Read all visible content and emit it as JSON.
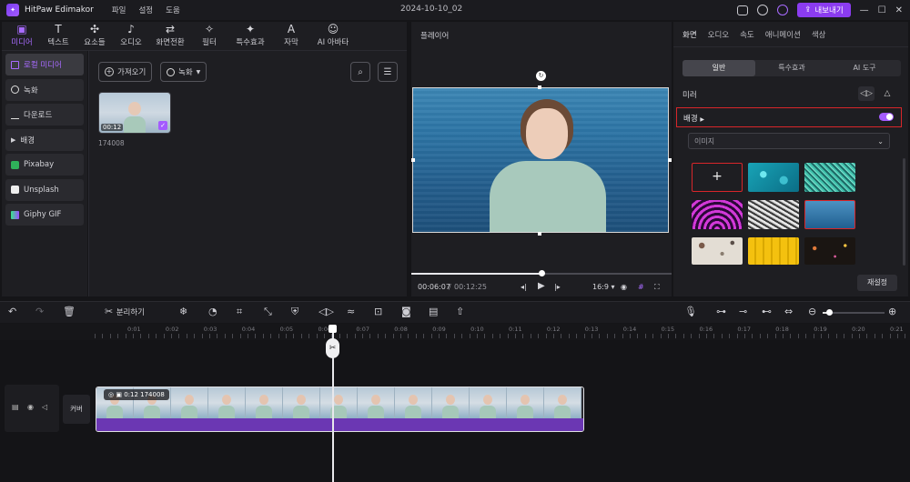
{
  "app": {
    "name": "HitPaw Edimakor",
    "menu": [
      "파일",
      "설정",
      "도움"
    ],
    "project_title": "2024-10-10_02",
    "export_label": "내보내기"
  },
  "media_tabs": [
    {
      "label": "미디어",
      "icon": "media-icon",
      "active": true
    },
    {
      "label": "텍스트",
      "icon": "text-icon"
    },
    {
      "label": "요소들",
      "icon": "elements-icon"
    },
    {
      "label": "오디오",
      "icon": "audio-icon"
    },
    {
      "label": "화면전환",
      "icon": "transition-icon"
    },
    {
      "label": "필터",
      "icon": "filter-icon"
    },
    {
      "label": "특수효과",
      "icon": "effects-icon"
    },
    {
      "label": "자막",
      "icon": "subtitle-icon"
    },
    {
      "label": "AI 아바타",
      "icon": "ai-avatar-icon"
    }
  ],
  "sidebar": {
    "items": [
      {
        "label": "로컬 미디어",
        "active": true
      },
      {
        "label": "녹화"
      },
      {
        "label": "다운로드"
      },
      {
        "label": "배경"
      },
      {
        "label": "Pixabay"
      },
      {
        "label": "Unsplash"
      },
      {
        "label": "Giphy GIF"
      }
    ]
  },
  "media": {
    "import_label": "가져오기",
    "record_label": "녹화",
    "clip": {
      "duration": "00:12",
      "name": "174008"
    }
  },
  "player": {
    "title": "플레이어",
    "current_time": "00:06:07",
    "total_time": "00:12:25",
    "aspect": "16:9",
    "progress": 0.5
  },
  "properties": {
    "tabs": [
      "화면",
      "오디오",
      "속도",
      "애니메이션",
      "색상"
    ],
    "active_tab": "화면",
    "sub_tabs": [
      "일반",
      "특수효과",
      "AI 도구"
    ],
    "active_sub": "일반",
    "mirror_label": "미러",
    "background_label": "배경",
    "background_enabled": true,
    "bg_type_select": "이미지",
    "add_label": "+",
    "reset_label": "재설정"
  },
  "timeline": {
    "split_label": "분리하기",
    "cover_label": "커버",
    "clip_label": "0:12 174008",
    "ruler": [
      "0:01",
      "0:02",
      "0:03",
      "0:04",
      "0:05",
      "0:06",
      "0:07",
      "0:08",
      "0:09",
      "0:10",
      "0:11",
      "0:12",
      "0:13",
      "0:14",
      "0:15",
      "0:16",
      "0:17",
      "0:18",
      "0:19",
      "0:20",
      "0:21"
    ]
  },
  "colors": {
    "accent": "#8b3cf0",
    "highlight": "#d8262a"
  }
}
